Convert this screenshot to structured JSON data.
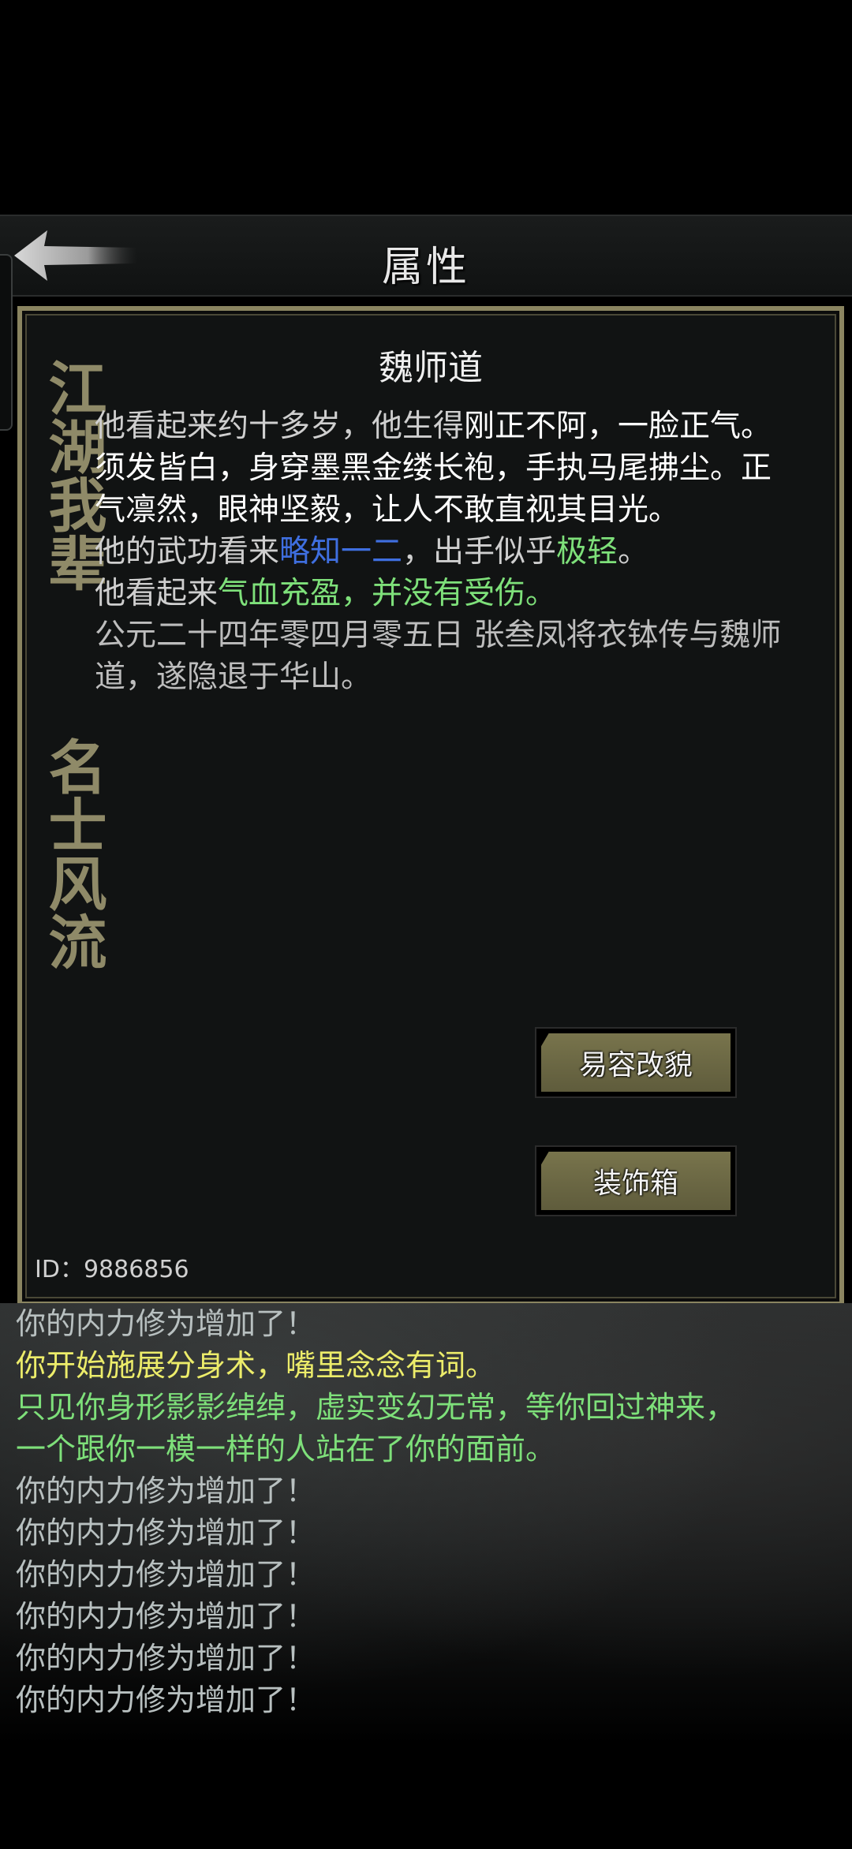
{
  "header": {
    "title": "属性"
  },
  "character": {
    "name": "魏师道",
    "id_label": "ID：9886856",
    "description": {
      "line1_pre": "他看起来约十多岁，他生得",
      "line1_hl": "刚正不阿，一脸正气。须发皆白，身穿墨黑金缕长袍，手执马尾拂尘。正气凛然，眼神坚毅，让人不敢直视其目光。",
      "line2_pre": "他的武功看来",
      "line2_skill": "略知一二",
      "line2_mid": "，出手似乎",
      "line2_speed": "极轻",
      "line2_end": "。",
      "line3_pre": "他看起来",
      "line3_health": "气血充盈，并没有受伤。",
      "line4": "公元二十四年零四月零五日 张叁凤将衣钵传与魏师道，遂隐退于华山。"
    }
  },
  "side_text": {
    "top": "江湖我辈",
    "bottom": "名士风流"
  },
  "buttons": {
    "appearance": "易容改貌",
    "decoration_box": "装饰箱"
  },
  "log": [
    {
      "text": "你的内力修为增加了！",
      "color": "gray"
    },
    {
      "text": "你开始施展分身术，嘴里念念有词。",
      "color": "yellow"
    },
    {
      "text": "只见你身形影影绰绰，虚实变幻无常，等你回过神来，",
      "color": "green"
    },
    {
      "text": "一个跟你一模一样的人站在了你的面前。",
      "color": "green"
    },
    {
      "text": "你的内力修为增加了！",
      "color": "gray"
    },
    {
      "text": "你的内力修为增加了！",
      "color": "gray"
    },
    {
      "text": "你的内力修为增加了！",
      "color": "gray"
    },
    {
      "text": "你的内力修为增加了！",
      "color": "gray"
    },
    {
      "text": "你的内力修为增加了！",
      "color": "gray"
    },
    {
      "text": "你的内力修为增加了！",
      "color": "gray"
    }
  ],
  "icons": {
    "back": "back-arrow-icon"
  },
  "colors": {
    "frame": "#8a8460",
    "skill_blue": "#3f6fe0",
    "health_green": "#7ee07a",
    "log_yellow": "#ecec6a"
  }
}
